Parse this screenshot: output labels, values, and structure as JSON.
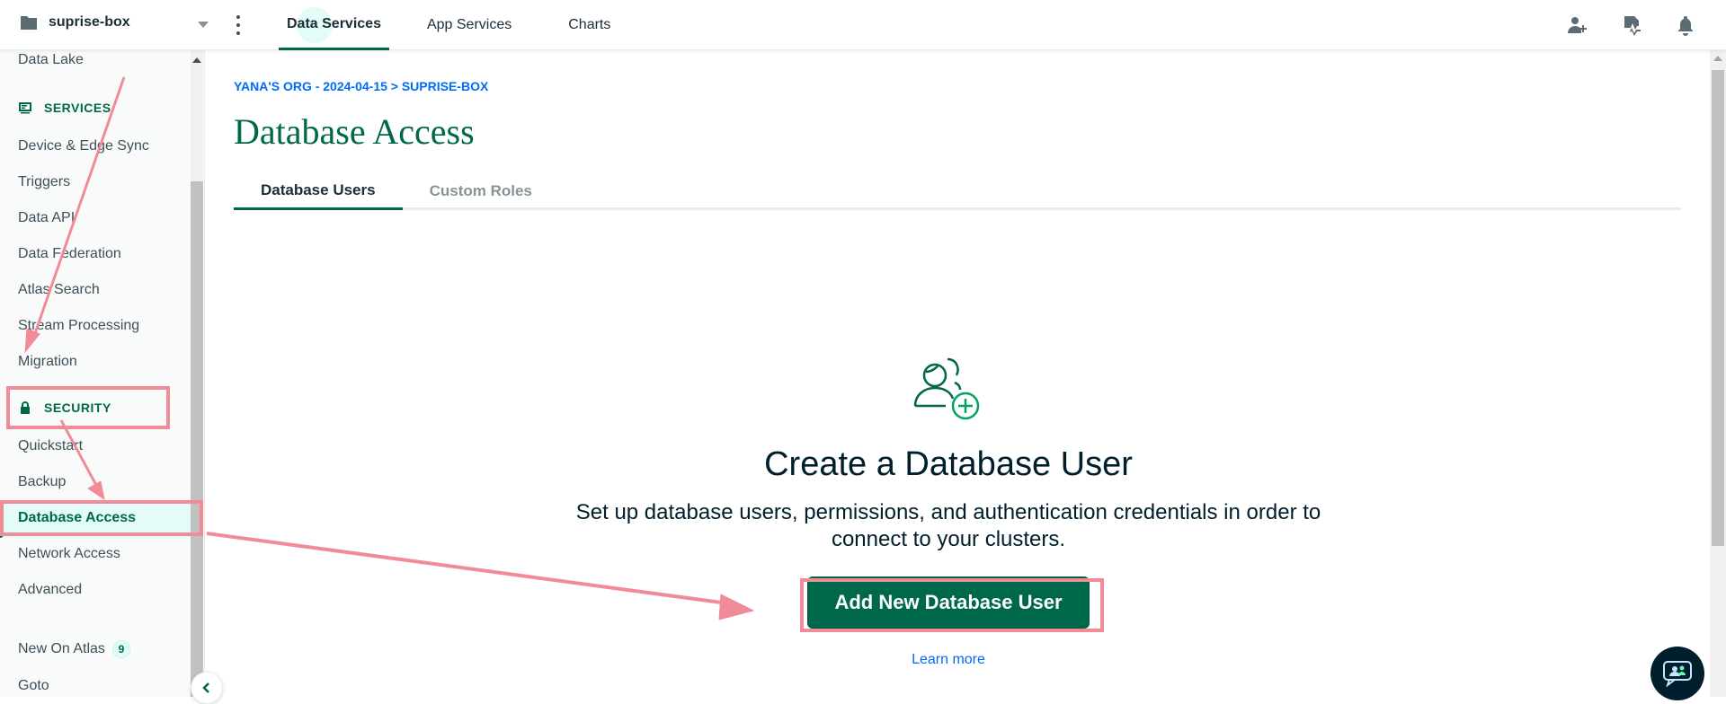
{
  "topbar": {
    "project_name": "suprise-box",
    "tabs": [
      {
        "label": "Data Services"
      },
      {
        "label": "App Services"
      },
      {
        "label": "Charts"
      }
    ]
  },
  "sidebar": {
    "data_lake": "Data Lake",
    "services_heading": "SERVICES",
    "services_items": [
      "Device & Edge Sync",
      "Triggers",
      "Data API",
      "Data Federation",
      "Atlas Search",
      "Stream Processing",
      "Migration"
    ],
    "security_heading": "SECURITY",
    "security_items": [
      "Quickstart",
      "Backup",
      "Database Access",
      "Network Access",
      "Advanced"
    ],
    "new_on_atlas": "New On Atlas",
    "new_on_atlas_count": "9",
    "goto": "Goto"
  },
  "main": {
    "breadcrumb": "YANA'S ORG - 2024-04-15 > SUPRISE-BOX",
    "title": "Database Access",
    "tabs": [
      "Database Users",
      "Custom Roles"
    ],
    "empty_title": "Create a Database User",
    "empty_desc_line1": "Set up database users, permissions, and authentication credentials in order to",
    "empty_desc_line2": "connect to your clusters.",
    "add_button": "Add New Database User",
    "learn_more": "Learn more"
  },
  "colors": {
    "accent_green": "#00684a",
    "link_blue": "#016bf8",
    "annotation_pink": "#f28b98"
  }
}
